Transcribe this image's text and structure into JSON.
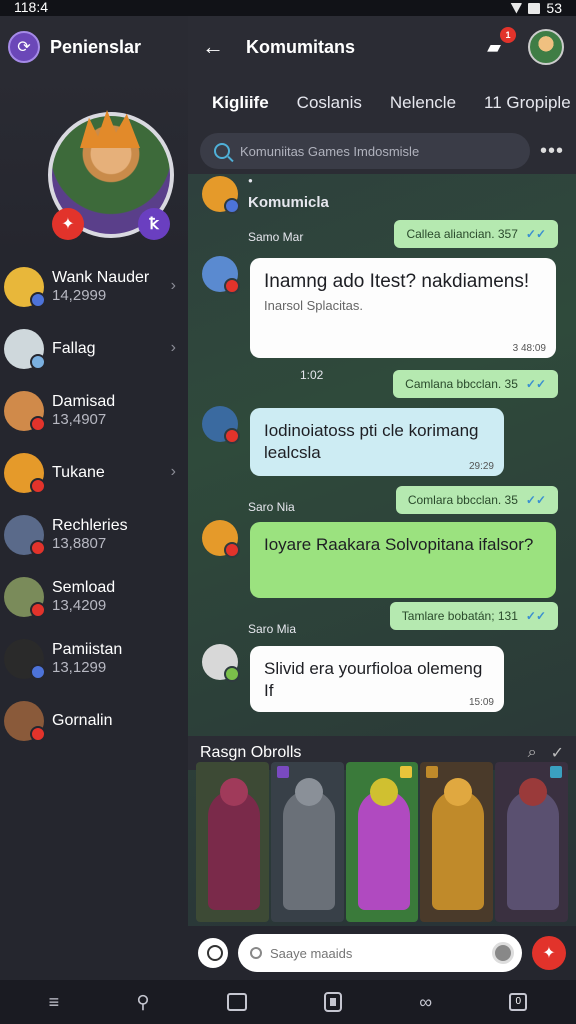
{
  "status_bar": {
    "time": "118:4",
    "battery": "53"
  },
  "sidebar": {
    "title": "Penienslar",
    "friends": [
      {
        "name": "Wank Nauder",
        "number": "14,2999",
        "chevron": true,
        "dot": "#4d73d9",
        "avatar": "#e8b73a"
      },
      {
        "name": "Fallag",
        "number": "",
        "chevron": true,
        "dot": "#7bb0e0",
        "avatar": "#cfd8dc"
      },
      {
        "name": "Damisad",
        "number": "13,4907",
        "chevron": false,
        "dot": "#e2332b",
        "avatar": "#d08a4a"
      },
      {
        "name": "Tukane",
        "number": "",
        "chevron": true,
        "dot": "#e2332b",
        "avatar": "#e59a2a"
      },
      {
        "name": "Rechleries",
        "number": "13,8807",
        "chevron": false,
        "dot": "#e2332b",
        "avatar": "#5a6a8a"
      },
      {
        "name": "Semload",
        "number": "13,4209",
        "chevron": false,
        "dot": "#e2332b",
        "avatar": "#7a8b5a"
      },
      {
        "name": "Pamiistan",
        "number": "13,1299",
        "chevron": false,
        "dot": "#4d73d9",
        "avatar": "#2a2a2a"
      },
      {
        "name": "Gornalin",
        "number": "",
        "chevron": false,
        "dot": "#e2332b",
        "avatar": "#8a5a3a"
      }
    ]
  },
  "header": {
    "title": "Komumitans",
    "notification_count": "1",
    "tabs": [
      "Kigliife",
      "Coslanis",
      "Nelencle",
      "11 Gropiple"
    ]
  },
  "search": {
    "placeholder": "Komuniitas Games Imdosmisle"
  },
  "chat": {
    "group_label": "Komumicla",
    "messages": [
      {
        "sender": "Samo Mar",
        "ts": "Callea aliancian. 357"
      },
      {
        "text": "Inamng ado Itest? nakdiamens!",
        "sub": "Inarsol Splacitas.",
        "time": "3 48:09"
      },
      {
        "sender": "1:02",
        "ts": "Camlana bbcclan. 35"
      },
      {
        "text": "Iodinoiatoss pti cle korimang lealcsla",
        "time": "29:29"
      },
      {
        "sender": "Saro Nia",
        "ts": "Comlara bbcclan. 35"
      },
      {
        "text": "Ioyare Raakara Solvopitana ifalsor?",
        "time": ""
      },
      {
        "sender": "Saro Mia",
        "ts": "Tamlare bobatán; 131"
      },
      {
        "text": "Slivid era yourfioloa olemeng If",
        "time": "15:09"
      }
    ]
  },
  "gallery": {
    "title": "Rasgn Obrolls"
  },
  "composer": {
    "placeholder": "Saaye maaids"
  },
  "colors": {
    "accent_red": "#e2332b",
    "bubble_green": "#9be27f",
    "bubble_cyan": "#cdecf3",
    "pill_green": "#b5e9b0"
  }
}
